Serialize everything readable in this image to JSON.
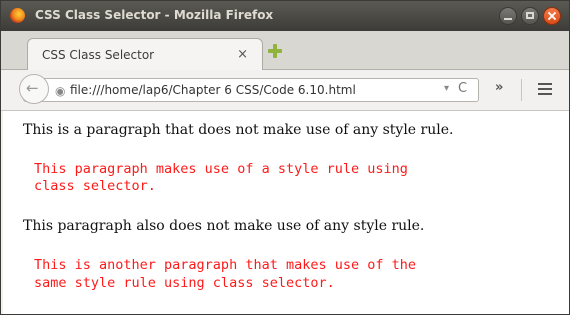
{
  "window": {
    "title": "CSS Class Selector - Mozilla Firefox"
  },
  "tabs": [
    {
      "label": "CSS Class Selector",
      "close": "×"
    }
  ],
  "navbar": {
    "url": "file:///home/lap6/Chapter 6 CSS/Code 6.10.html",
    "overflow": "»"
  },
  "page": {
    "para1": "This is a paragraph that does not make use of any style rule.",
    "para2_line1": "This paragraph makes use of a style rule using",
    "para2_line2": "class selector.",
    "para3": "This paragraph also does not make use of any style rule.",
    "para4_line1": "This is another paragraph that makes use of the",
    "para4_line2": "same style rule using class selector.",
    "class_text_color": "#ff1a1a"
  },
  "icons": [
    "firefox-icon",
    "minimize-icon",
    "maximize-icon",
    "close-icon",
    "new-tab-icon",
    "back-icon",
    "globe-icon",
    "dropdown-icon",
    "reload-icon",
    "menu-icon"
  ]
}
